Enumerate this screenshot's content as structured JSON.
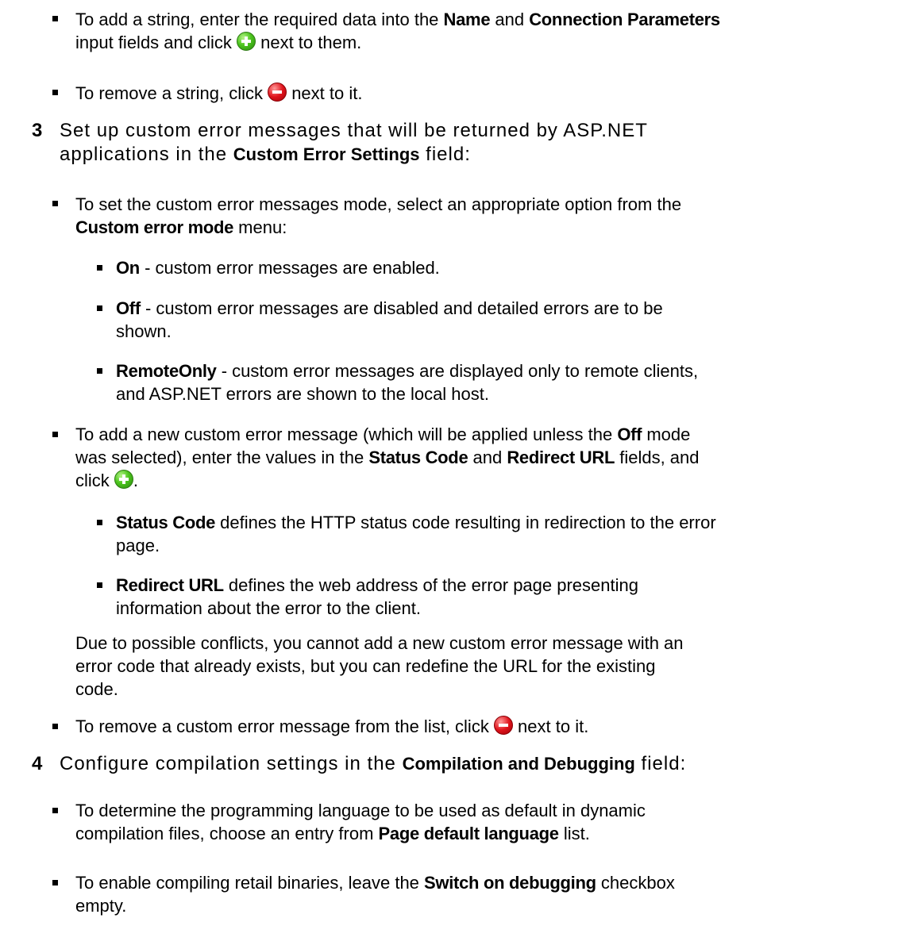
{
  "items": {
    "add_string": {
      "t1": "To add a string, enter the required data into the ",
      "b1": "Name",
      "t2": " and ",
      "b2": "Connection Parameters",
      "t3": "input fields and click ",
      "t4": " next to them.",
      "icon": "add-icon"
    },
    "remove_string": {
      "t1": "To remove a string, click ",
      "t2": " next to it.",
      "icon": "remove-icon"
    }
  },
  "step3": {
    "number": "3",
    "line1": "Set up custom error messages that will be returned by ASP.NET",
    "line2a": "applications in the ",
    "line2b": "Custom Error Settings",
    "line2c": " field:"
  },
  "mode": {
    "t1": "To set the custom error messages mode, select an appropriate option from the",
    "b1": "Custom error mode",
    "t2": " menu:"
  },
  "options": {
    "on": {
      "name": "On",
      "desc": " - custom error messages are enabled."
    },
    "off": {
      "name": "Off",
      "desc": " - custom error messages are disabled and detailed errors are to be",
      "desc2": "shown."
    },
    "remote": {
      "name": "RemoteOnly",
      "desc": " - custom error messages are displayed only to remote clients,",
      "desc2": "and ASP.NET errors are shown to the local host."
    }
  },
  "add_error": {
    "t1": "To add a new custom error message (which will be applied unless the ",
    "b1": "Off",
    "t2": " mode",
    "t3": "was selected), enter the values in the ",
    "b2": "Status Code",
    "t4": " and ",
    "b3": "Redirect URL",
    "t5": " fields, and",
    "t6": "click ",
    "t7": ".",
    "icon": "add-icon"
  },
  "status_code": {
    "name": "Status Code",
    "desc": " defines the HTTP status code resulting in redirection to the error",
    "desc2": "page."
  },
  "redirect_url": {
    "name": "Redirect URL",
    "desc": " defines the web address of the error page presenting",
    "desc2": "information about the error to the client."
  },
  "note": {
    "line1": "Due to possible conflicts, you cannot add a new custom error message with an",
    "line2": "error code that already exists, but you can redefine the URL for the existing",
    "line3": "code."
  },
  "remove_error": {
    "t1": "To remove a custom error message from the list, click ",
    "t2": " next to it.",
    "icon": "remove-icon"
  },
  "step4": {
    "number": "4",
    "t1": "Configure compilation settings in the ",
    "b1": "Compilation and Debugging",
    "t2": " field:"
  },
  "lang": {
    "t1": "To determine the programming language to be used as default in dynamic",
    "t2": "compilation files, choose an entry from ",
    "b1": "Page default language",
    "t3": " list."
  },
  "debug": {
    "t1": "To enable compiling retail binaries, leave the ",
    "b1": "Switch on debugging",
    "t2": " checkbox",
    "t3": "empty."
  }
}
